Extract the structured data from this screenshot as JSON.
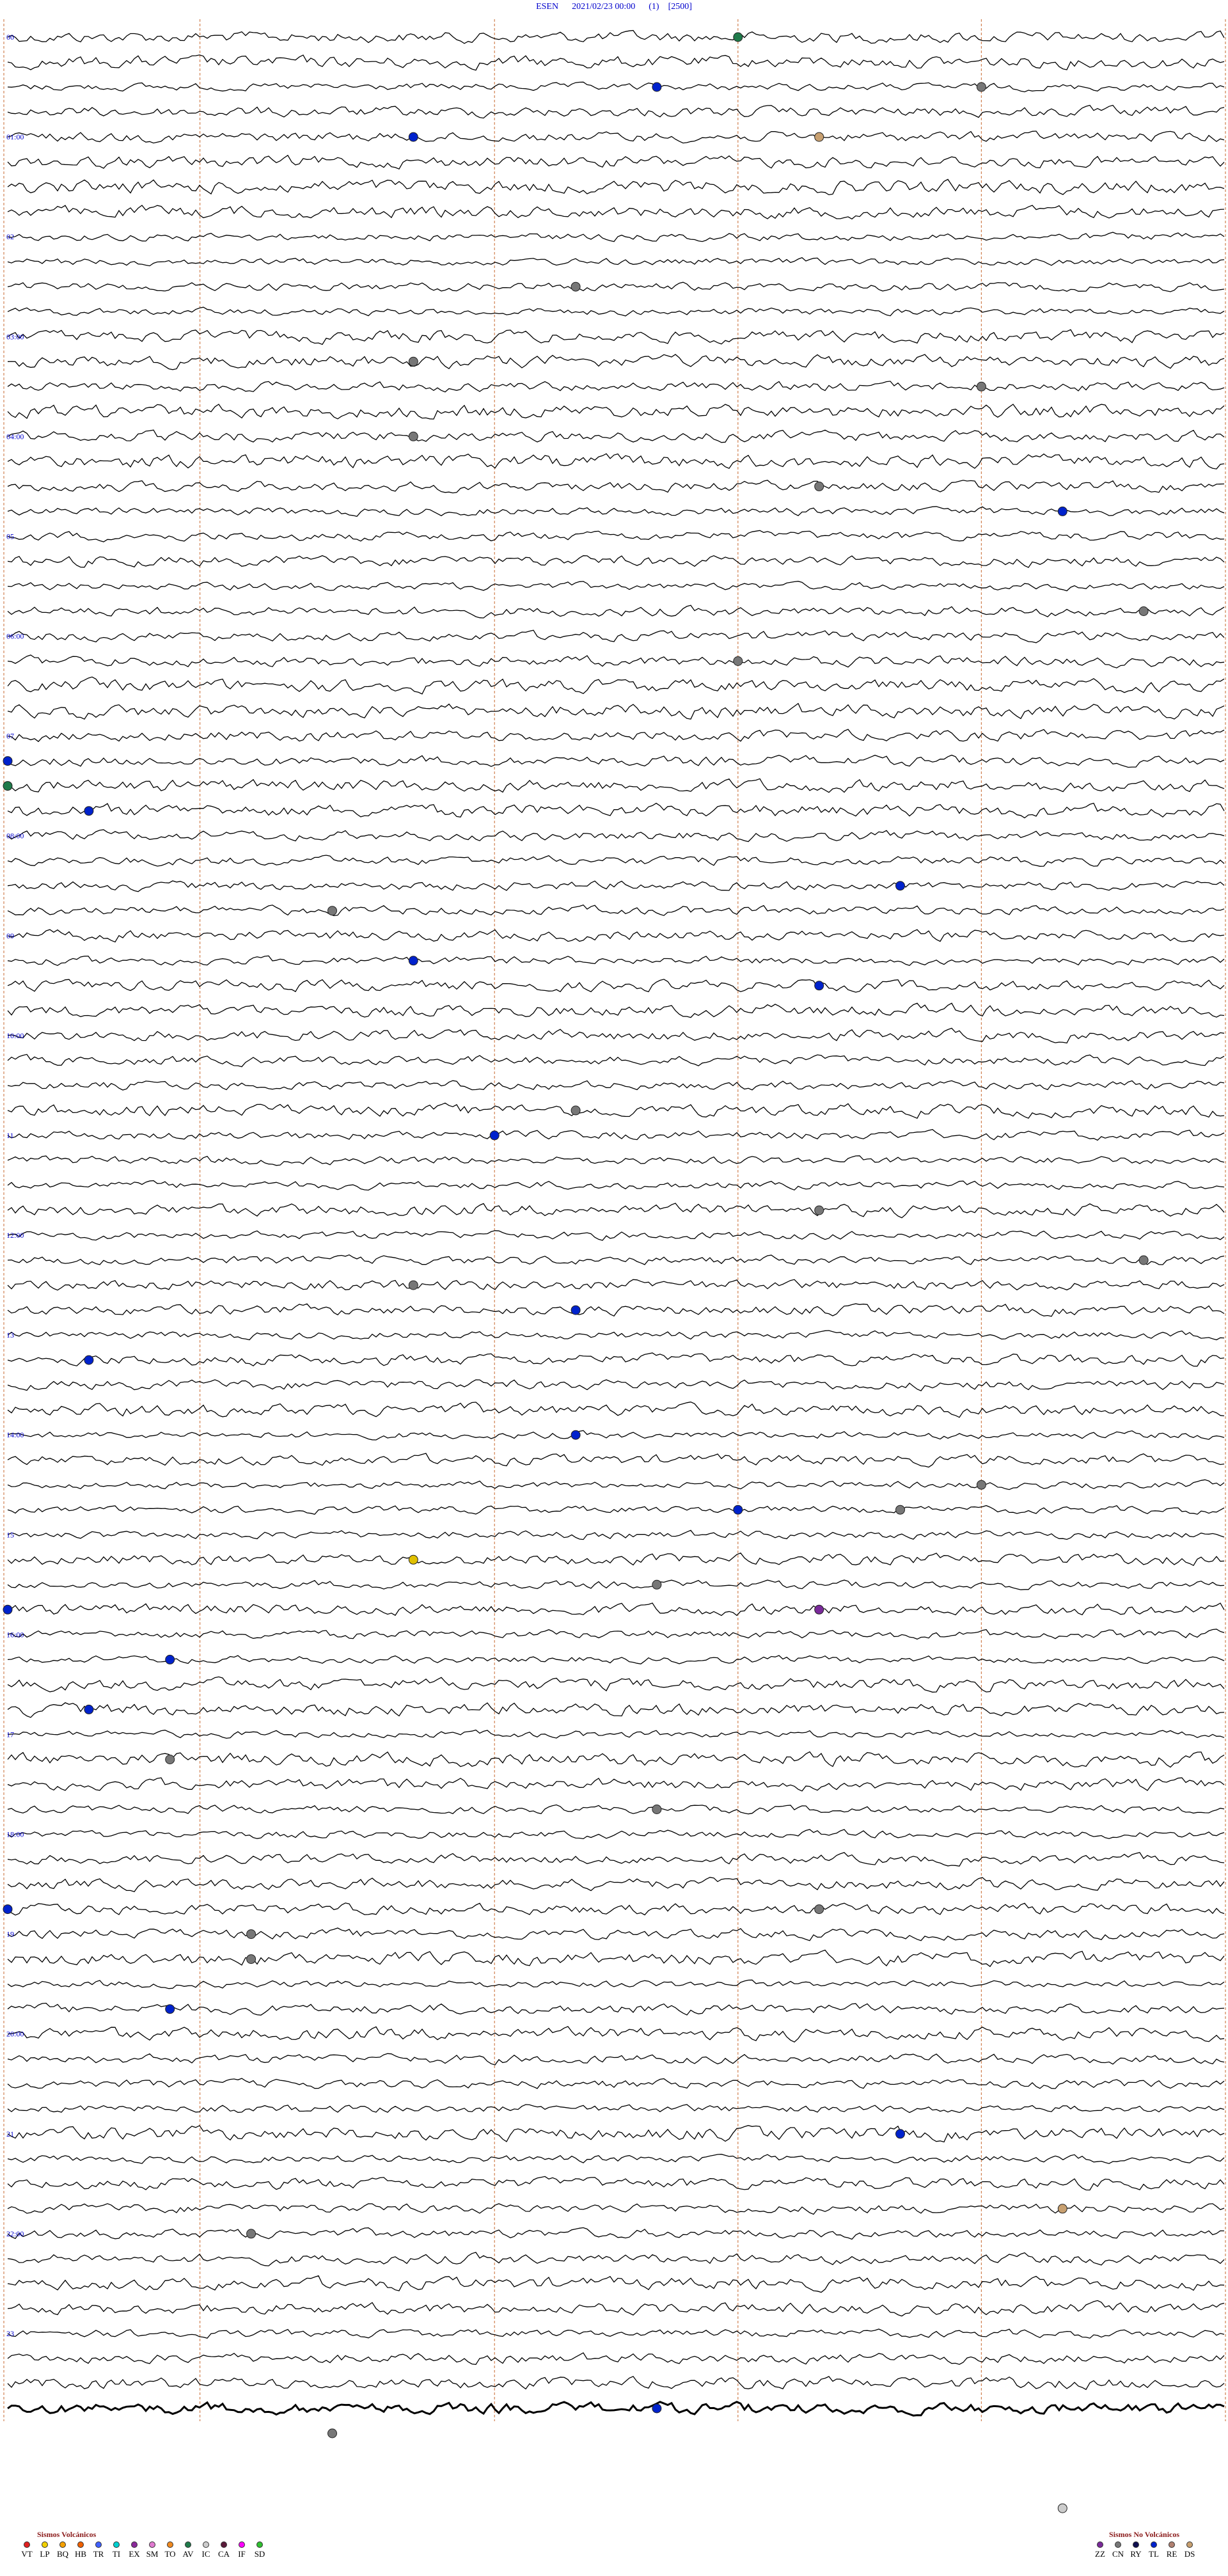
{
  "header": {
    "station": "ESEN",
    "datetime": "2021/02/23 00:00",
    "component": "(1)",
    "scale": "[2500]"
  },
  "chart_data": {
    "type": "seismogram",
    "traces_per_hour": 4,
    "hours": 24,
    "hour_labels": [
      "00",
      "01:00",
      "02",
      "03:00",
      "04:00",
      "05",
      "06:00",
      "07",
      "08:00",
      "09",
      "10:00",
      "11",
      "12:00",
      "13",
      "14:00",
      "15",
      "16:00",
      "17",
      "18:00",
      "19",
      "20:00",
      "21",
      "22:00",
      "23"
    ],
    "events": [
      {
        "hour": 0,
        "minute": 9,
        "color": "#1f7a4a"
      },
      {
        "hour": 0,
        "minute": 38,
        "color": "#0022cc"
      },
      {
        "hour": 0,
        "minute": 42,
        "color": "#777777"
      },
      {
        "hour": 1,
        "minute": 5,
        "color": "#0022cc"
      },
      {
        "hour": 1,
        "minute": 10,
        "color": "#c8a070"
      },
      {
        "hour": 2,
        "minute": 37,
        "color": "#777777"
      },
      {
        "hour": 3,
        "minute": 20,
        "color": "#777777"
      },
      {
        "hour": 3,
        "minute": 42,
        "color": "#777777"
      },
      {
        "hour": 4,
        "minute": 5,
        "color": "#777777"
      },
      {
        "hour": 4,
        "minute": 40,
        "color": "#777777"
      },
      {
        "hour": 4,
        "minute": 58,
        "color": "#0022cc"
      },
      {
        "hour": 6,
        "minute": 24,
        "color": "#777777"
      },
      {
        "hour": 5,
        "minute": 59,
        "color": "#777777"
      },
      {
        "hour": 7,
        "minute": 15,
        "color": "#0022cc"
      },
      {
        "hour": 7,
        "minute": 30,
        "color": "#1f7a4a"
      },
      {
        "hour": 7,
        "minute": 46,
        "color": "#0022cc"
      },
      {
        "hour": 8,
        "minute": 49,
        "color": "#777777"
      },
      {
        "hour": 8,
        "minute": 41,
        "color": "#0022cc"
      },
      {
        "hour": 9,
        "minute": 40,
        "color": "#0022cc"
      },
      {
        "hour": 9,
        "minute": 20,
        "color": "#0022cc"
      },
      {
        "hour": 10,
        "minute": 52,
        "color": "#777777"
      },
      {
        "hour": 11,
        "minute": 6,
        "color": "#0022cc"
      },
      {
        "hour": 11,
        "minute": 55,
        "color": "#777777"
      },
      {
        "hour": 12,
        "minute": 29,
        "color": "#777777"
      },
      {
        "hour": 12,
        "minute": 52,
        "color": "#0022cc"
      },
      {
        "hour": 12,
        "minute": 35,
        "color": "#777777"
      },
      {
        "hour": 13,
        "minute": 16,
        "color": "#0022cc"
      },
      {
        "hour": 14,
        "minute": 56,
        "color": "#777777"
      },
      {
        "hour": 14,
        "minute": 7,
        "color": "#0022cc"
      },
      {
        "hour": 14,
        "minute": 54,
        "color": "#0022cc"
      },
      {
        "hour": 14,
        "minute": 42,
        "color": "#777777"
      },
      {
        "hour": 15,
        "minute": 38,
        "color": "#777777"
      },
      {
        "hour": 15,
        "minute": 20,
        "color": "#e0c000"
      },
      {
        "hour": 15,
        "minute": 55,
        "color": "#7a2a9a"
      },
      {
        "hour": 15,
        "minute": 45,
        "color": "#0022cc"
      },
      {
        "hour": 16,
        "minute": 17,
        "color": "#0022cc"
      },
      {
        "hour": 16,
        "minute": 46,
        "color": "#0022cc"
      },
      {
        "hour": 17,
        "minute": 17,
        "color": "#777777"
      },
      {
        "hour": 17,
        "minute": 53,
        "color": "#777777"
      },
      {
        "hour": 18,
        "minute": 55,
        "color": "#777777"
      },
      {
        "hour": 18,
        "minute": 45,
        "color": "#0022cc"
      },
      {
        "hour": 19,
        "minute": 18,
        "color": "#777777"
      },
      {
        "hour": 19,
        "minute": 47,
        "color": "#0022cc"
      },
      {
        "hour": 19,
        "minute": 3,
        "color": "#777777"
      },
      {
        "hour": 21,
        "minute": 11,
        "color": "#0022cc"
      },
      {
        "hour": 21,
        "minute": 58,
        "color": "#c8a070"
      },
      {
        "hour": 22,
        "minute": 3,
        "color": "#777777"
      },
      {
        "hour": 23,
        "minute": 53,
        "color": "#0022cc"
      },
      {
        "hour": 24,
        "minute": 4,
        "color": "#777777"
      },
      {
        "hour": 24,
        "minute": 58,
        "color": "#cccccc"
      }
    ]
  },
  "legend_volcanic": {
    "title": "Sismos Volcánicos",
    "items": [
      {
        "code": "VT",
        "color": "#e02020"
      },
      {
        "code": "LP",
        "color": "#f0d000"
      },
      {
        "code": "BQ",
        "color": "#f5a000"
      },
      {
        "code": "HB",
        "color": "#f06000"
      },
      {
        "code": "TR",
        "color": "#4060ff"
      },
      {
        "code": "TI",
        "color": "#00d0d0"
      },
      {
        "code": "EX",
        "color": "#8a2a9a"
      },
      {
        "code": "SM",
        "color": "#e07ad0"
      },
      {
        "code": "TO",
        "color": "#f08a20"
      },
      {
        "code": "AV",
        "color": "#1f7a4a"
      },
      {
        "code": "IC",
        "color": "#cccccc"
      },
      {
        "code": "CA",
        "color": "#5a1a3a"
      },
      {
        "code": "IF",
        "color": "#ff00ff"
      },
      {
        "code": "SD",
        "color": "#30c030"
      }
    ]
  },
  "legend_nonvolcanic": {
    "title": "Sismos No Volcánicos",
    "items": [
      {
        "code": "ZZ",
        "color": "#7a2a9a"
      },
      {
        "code": "CN",
        "color": "#777777"
      },
      {
        "code": "RY",
        "color": "#101050"
      },
      {
        "code": "TL",
        "color": "#0022cc"
      },
      {
        "code": "RE",
        "color": "#b08070"
      },
      {
        "code": "DS",
        "color": "#c8a070"
      }
    ]
  }
}
